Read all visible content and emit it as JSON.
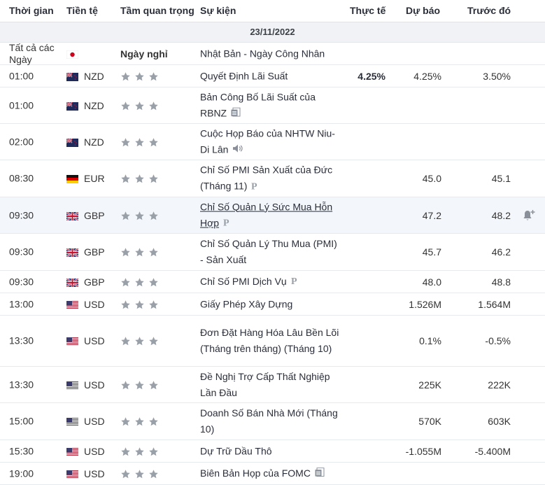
{
  "header": {
    "time": "Thời gian",
    "currency": "Tiền tệ",
    "importance": "Tầm quan trọng",
    "event": "Sự kiện",
    "actual": "Thực tế",
    "forecast": "Dự báo",
    "previous": "Trước đó"
  },
  "date": "23/11/2022",
  "colors": {
    "star": "#9aa0a8",
    "highlight_row": "#f3f6fb",
    "date_row": "#f0f2f5"
  },
  "rows": [
    {
      "time": "Tất cả các Ngày",
      "flag": "JP",
      "currency": "",
      "holiday": "Ngày nghỉ",
      "event": "Nhật Bản - Ngày Công Nhân",
      "icon": "",
      "actual": "",
      "forecast": "",
      "previous": ""
    },
    {
      "time": "01:00",
      "flag": "NZ",
      "currency": "NZD",
      "holiday": "",
      "event": "Quyết Định Lãi Suất",
      "icon": "",
      "actual": "4.25%",
      "forecast": "4.25%",
      "previous": "3.50%"
    },
    {
      "time": "01:00",
      "flag": "NZ",
      "currency": "NZD",
      "holiday": "",
      "event": "Bản Công Bố Lãi Suất của RBNZ",
      "icon": "document-icon",
      "actual": "",
      "forecast": "",
      "previous": ""
    },
    {
      "time": "02:00",
      "flag": "NZ",
      "currency": "NZD",
      "holiday": "",
      "event": "Cuộc Họp Báo của NHTW Niu-Di Lân",
      "icon": "speaker-icon",
      "actual": "",
      "forecast": "",
      "previous": ""
    },
    {
      "time": "08:30",
      "flag": "DE",
      "currency": "EUR",
      "holiday": "",
      "event": "Chỉ Số PMI Sản Xuất của Đức (Tháng 11)",
      "icon": "preliminary-icon",
      "actual": "",
      "forecast": "45.0",
      "previous": "45.1"
    },
    {
      "time": "09:30",
      "flag": "GB",
      "currency": "GBP",
      "holiday": "",
      "event": "Chỉ Số Quản Lý Sức Mua Hỗn Hợp",
      "icon": "preliminary-icon",
      "actual": "",
      "forecast": "47.2",
      "previous": "48.2",
      "link": true
    },
    {
      "time": "09:30",
      "flag": "GB",
      "currency": "GBP",
      "holiday": "",
      "event": "Chỉ Số Quản Lý Thu Mua (PMI) - Sản Xuất",
      "icon": "",
      "actual": "",
      "forecast": "45.7",
      "previous": "46.2"
    },
    {
      "time": "09:30",
      "flag": "GB",
      "currency": "GBP",
      "holiday": "",
      "event": "Chỉ Số PMI Dịch Vụ",
      "icon": "preliminary-icon",
      "actual": "",
      "forecast": "48.0",
      "previous": "48.8"
    },
    {
      "time": "13:00",
      "flag": "US",
      "currency": "USD",
      "holiday": "",
      "event": "Giấy Phép Xây Dựng",
      "icon": "",
      "actual": "",
      "forecast": "1.526M",
      "previous": "1.564M"
    },
    {
      "time": "13:30",
      "flag": "US",
      "currency": "USD",
      "holiday": "",
      "event": "Đơn Đặt Hàng Hóa Lâu Bền Lõi (Tháng trên tháng) (Tháng 10)",
      "icon": "",
      "actual": "",
      "forecast": "0.1%",
      "previous": "-0.5%"
    },
    {
      "time": "13:30",
      "flag": "US",
      "currency": "USD",
      "holiday": "",
      "event": "Đề Nghị Trợ Cấp Thất Nghiệp Lần Đầu",
      "icon": "",
      "actual": "",
      "forecast": "225K",
      "previous": "222K"
    },
    {
      "time": "15:00",
      "flag": "US",
      "currency": "USD",
      "holiday": "",
      "event": "Doanh Số Bán Nhà Mới (Tháng 10)",
      "icon": "",
      "actual": "",
      "forecast": "570K",
      "previous": "603K"
    },
    {
      "time": "15:30",
      "flag": "US",
      "currency": "USD",
      "holiday": "",
      "event": "Dự Trữ Dầu Thô",
      "icon": "",
      "actual": "",
      "forecast": "-1.055M",
      "previous": "-5.400M"
    },
    {
      "time": "19:00",
      "flag": "US",
      "currency": "USD",
      "holiday": "",
      "event": "Biên Bản Họp của FOMC",
      "icon": "document-icon",
      "actual": "",
      "forecast": "",
      "previous": ""
    }
  ]
}
